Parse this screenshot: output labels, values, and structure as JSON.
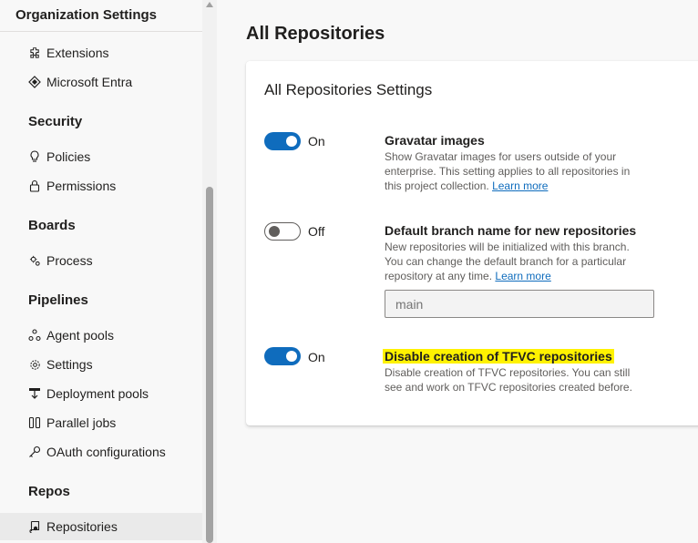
{
  "sidebar": {
    "title": "Organization Settings",
    "top_items": [
      {
        "label": "Extensions",
        "icon": "puzzle-icon"
      },
      {
        "label": "Microsoft Entra",
        "icon": "entra-diamond-icon"
      }
    ],
    "sections": [
      {
        "heading": "Security",
        "items": [
          {
            "label": "Policies",
            "icon": "lightbulb-icon"
          },
          {
            "label": "Permissions",
            "icon": "lock-icon"
          }
        ]
      },
      {
        "heading": "Boards",
        "items": [
          {
            "label": "Process",
            "icon": "process-gear-icon"
          }
        ]
      },
      {
        "heading": "Pipelines",
        "items": [
          {
            "label": "Agent pools",
            "icon": "agent-pools-icon"
          },
          {
            "label": "Settings",
            "icon": "gear-icon"
          },
          {
            "label": "Deployment pools",
            "icon": "deployment-pools-icon"
          },
          {
            "label": "Parallel jobs",
            "icon": "parallel-jobs-icon"
          },
          {
            "label": "OAuth configurations",
            "icon": "key-icon"
          }
        ]
      },
      {
        "heading": "Repos",
        "items": [
          {
            "label": "Repositories",
            "icon": "repo-icon",
            "selected": true
          }
        ]
      }
    ]
  },
  "main": {
    "page_title": "All Repositories",
    "card_title": "All Repositories Settings",
    "settings": [
      {
        "toggle_state": "On",
        "title": "Gravatar images",
        "description": "Show Gravatar images for users outside of your enterprise. This setting applies to all repositories in this project collection.",
        "link": "Learn more"
      },
      {
        "toggle_state": "Off",
        "title": "Default branch name for new repositories",
        "description": "New repositories will be initialized with this branch. You can change the default branch for a particular repository at any time.",
        "link": "Learn more",
        "input_placeholder": "main"
      },
      {
        "toggle_state": "On",
        "title": "Disable creation of TFVC repositories",
        "description": "Disable creation of TFVC repositories. You can still see and work on TFVC repositories created before.",
        "highlight_color": "#fff200"
      }
    ]
  },
  "colors": {
    "accent": "#0f6cbd",
    "highlight": "#fff200",
    "selected_bg": "#eaeaea"
  }
}
